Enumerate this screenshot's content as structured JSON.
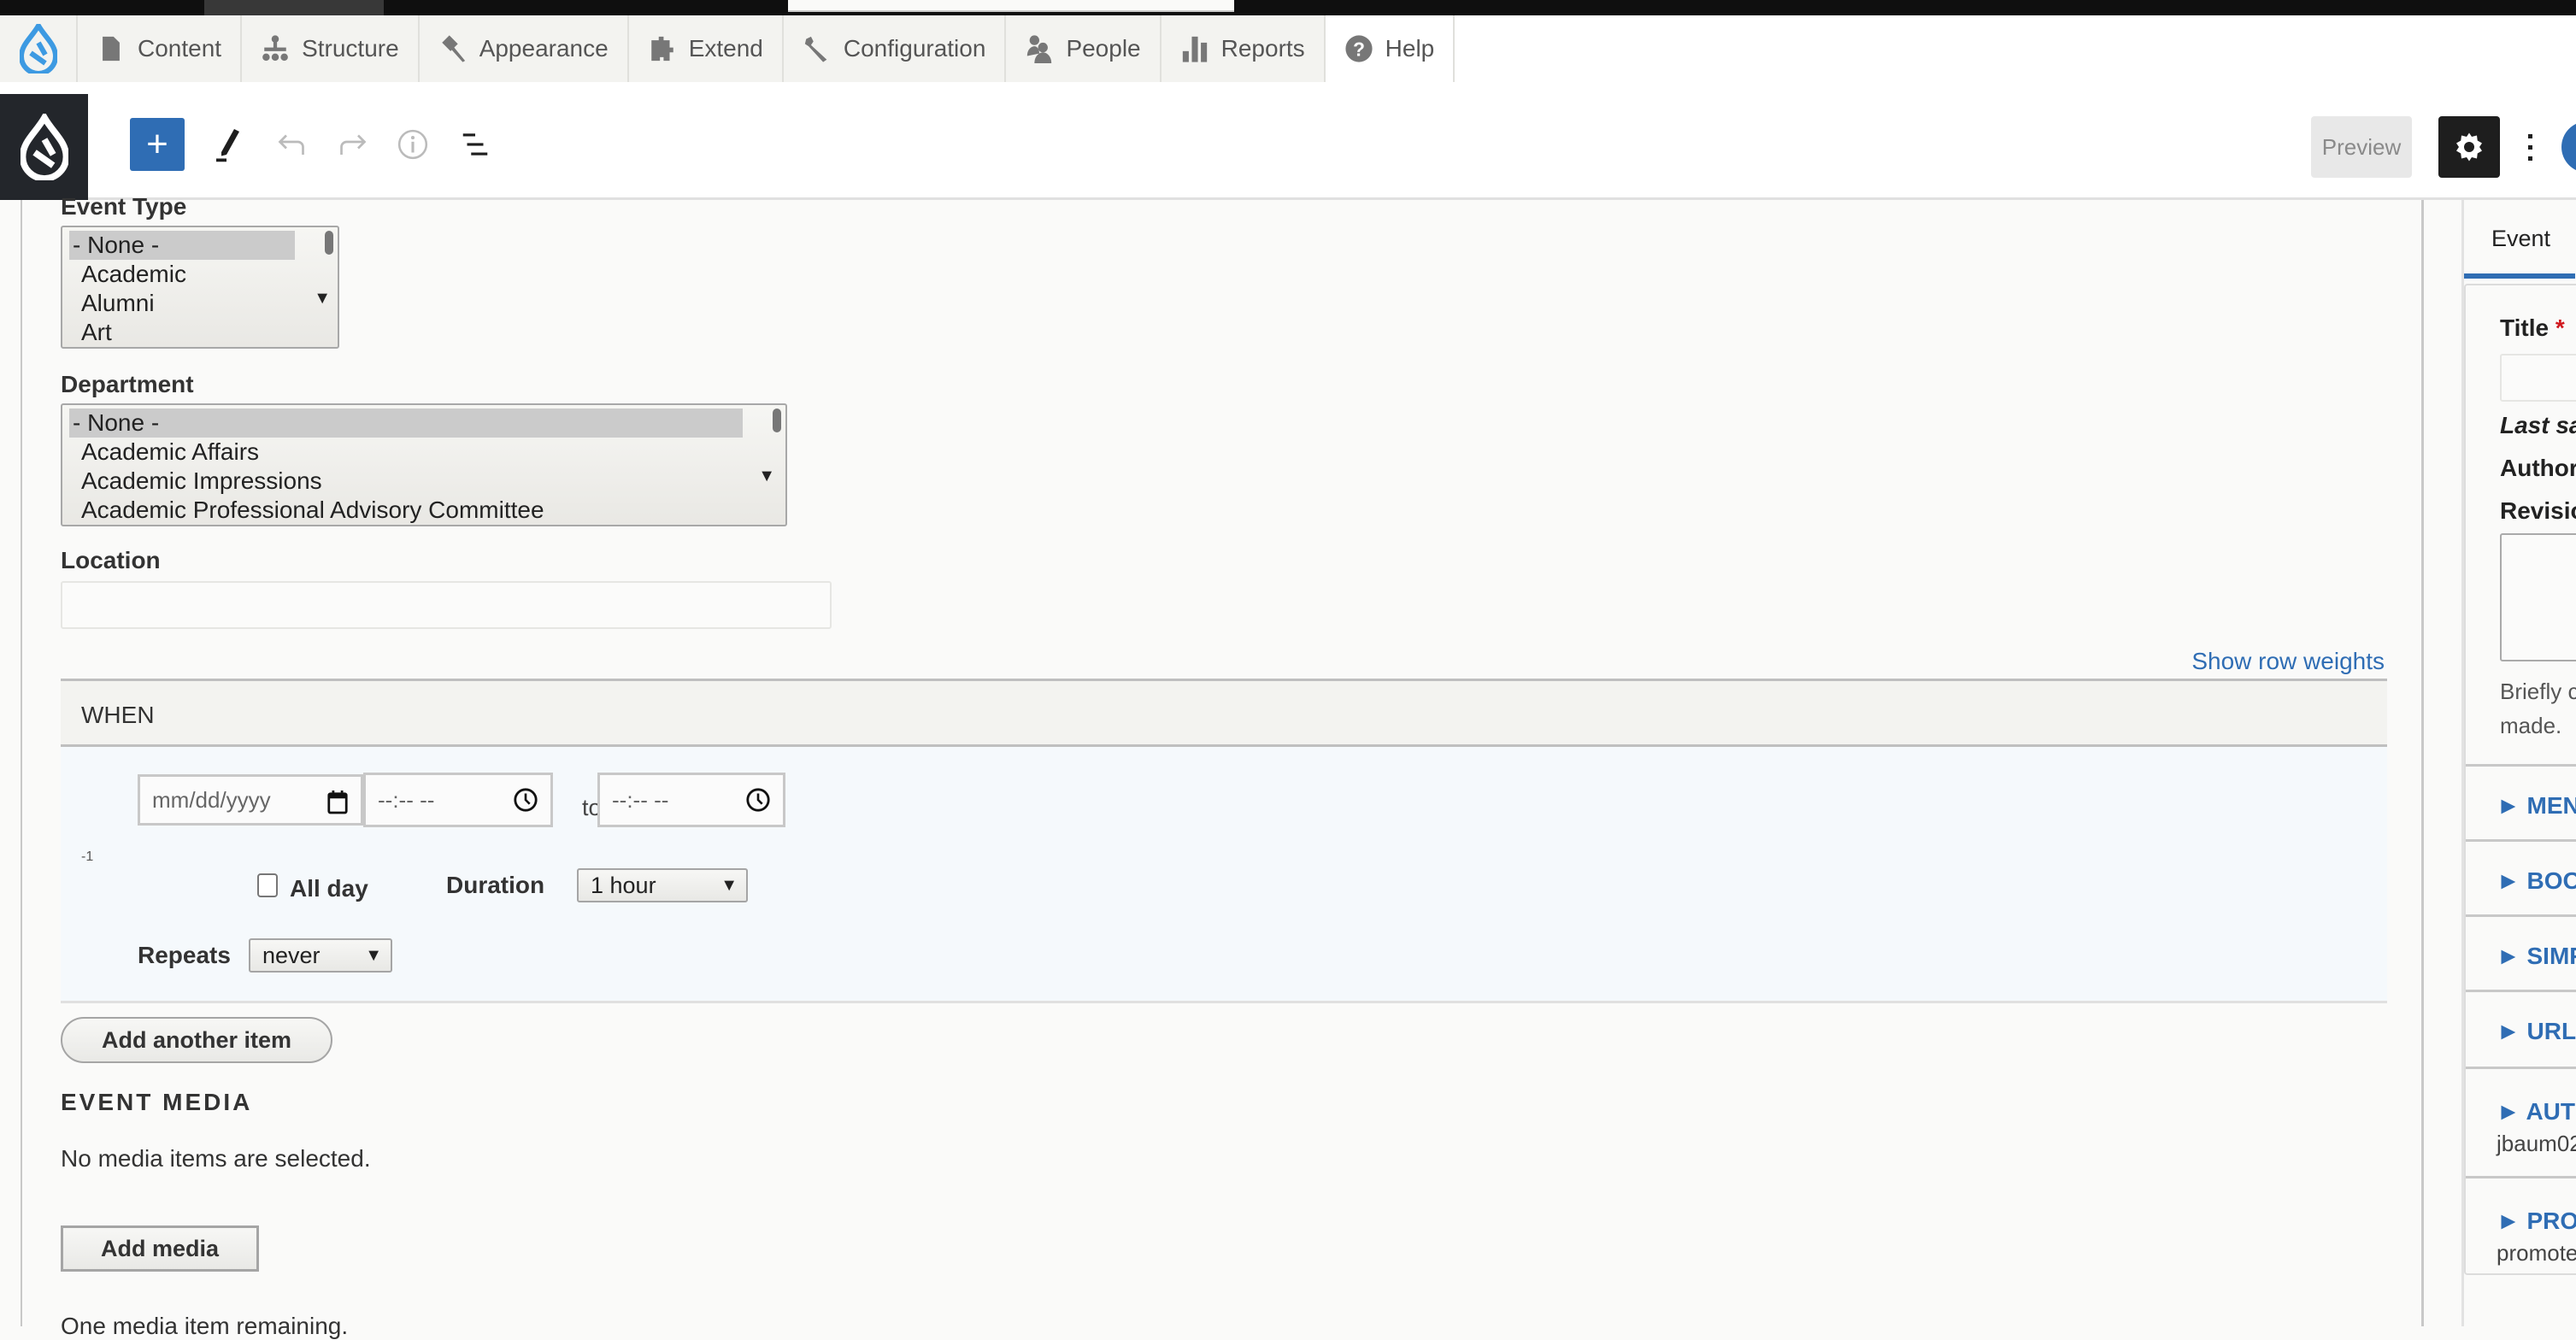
{
  "admin_menu": {
    "items": [
      {
        "label": "Content",
        "icon": "file-icon"
      },
      {
        "label": "Structure",
        "icon": "sitemap-icon"
      },
      {
        "label": "Appearance",
        "icon": "paintbrush-icon"
      },
      {
        "label": "Extend",
        "icon": "puzzle-icon"
      },
      {
        "label": "Configuration",
        "icon": "wrench-icon"
      },
      {
        "label": "People",
        "icon": "people-icon"
      },
      {
        "label": "Reports",
        "icon": "bar-chart-icon"
      },
      {
        "label": "Help",
        "icon": "help-icon"
      }
    ]
  },
  "editor_toolbar": {
    "add_label": "+",
    "preview_label": "Preview"
  },
  "form": {
    "event_type": {
      "label": "Event Type",
      "options": [
        "- None -",
        "Academic",
        "Alumni",
        "Art"
      ],
      "selected": "- None -"
    },
    "department": {
      "label": "Department",
      "options": [
        "- None -",
        "Academic Affairs",
        "Academic Impressions",
        "Academic Professional Advisory Committee"
      ],
      "selected": "- None -"
    },
    "location": {
      "label": "Location",
      "value": ""
    },
    "show_row_weights": "Show row weights",
    "when": {
      "heading": "WHEN",
      "row_weight": "-1",
      "date_placeholder": "mm/dd/yyyy",
      "start_time_placeholder": "--:-- --",
      "to_label": "to",
      "end_time_placeholder": "--:-- --",
      "all_day_label": "All day",
      "all_day_checked": false,
      "duration_label": "Duration",
      "duration_value": "1 hour",
      "repeats_label": "Repeats",
      "repeats_value": "never"
    },
    "add_another_item": "Add another item",
    "event_media": {
      "heading": "EVENT MEDIA",
      "empty_text": "No media items are selected.",
      "add_media": "Add media",
      "remaining_text": "One media item remaining."
    }
  },
  "sidebar": {
    "tab": "Event",
    "title_label": "Title",
    "required_mark": "*",
    "title_value": "",
    "last_saved": "Last sa",
    "author": "Author",
    "revision_label": "Revisio",
    "revision_help_line1": "Briefly c",
    "revision_help_line2": "made.",
    "accordions": [
      {
        "title": "MENU",
        "sub": ""
      },
      {
        "title": "BOOK",
        "sub": ""
      },
      {
        "title": "SIMPL",
        "sub": ""
      },
      {
        "title": "URL A",
        "sub": ""
      },
      {
        "title": "AUTH",
        "sub": "jbaum02"
      },
      {
        "title": "PROM",
        "sub": "promote"
      }
    ]
  },
  "colors": {
    "accent": "#2f6db4",
    "required": "#d0181d",
    "dark": "#1e1e1e"
  }
}
